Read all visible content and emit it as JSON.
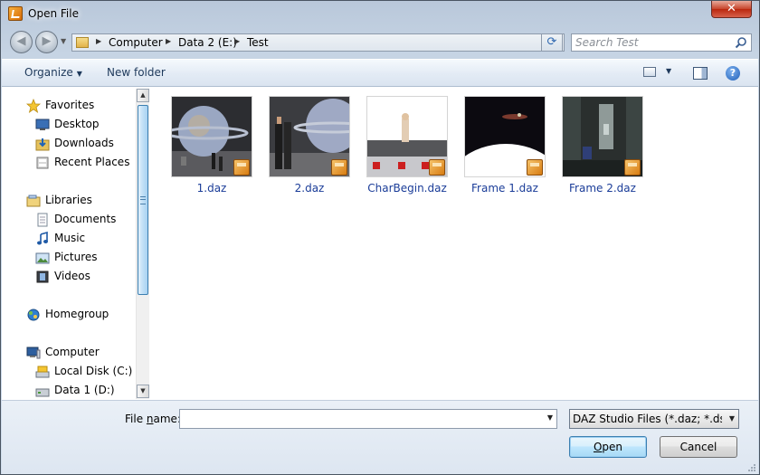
{
  "window": {
    "title": "Open File",
    "close_glyph": "✕"
  },
  "navbar": {
    "back_glyph": "◀",
    "forward_glyph": "▶",
    "breadcrumbs": [
      "Computer",
      "Data 2 (E:)",
      "Test"
    ],
    "search_placeholder": "Search Test"
  },
  "toolbar": {
    "organize_label": "Organize",
    "new_folder_label": "New folder",
    "help_glyph": "?"
  },
  "sidebar": {
    "groups": [
      {
        "label": "Favorites",
        "icon": "star-icon",
        "items": [
          {
            "label": "Desktop",
            "icon": "desktop-icon"
          },
          {
            "label": "Downloads",
            "icon": "downloads-icon"
          },
          {
            "label": "Recent Places",
            "icon": "recent-places-icon"
          }
        ]
      },
      {
        "label": "Libraries",
        "icon": "libraries-icon",
        "items": [
          {
            "label": "Documents",
            "icon": "documents-icon"
          },
          {
            "label": "Music",
            "icon": "music-icon"
          },
          {
            "label": "Pictures",
            "icon": "pictures-icon"
          },
          {
            "label": "Videos",
            "icon": "videos-icon"
          }
        ]
      },
      {
        "label": "Homegroup",
        "icon": "homegroup-icon",
        "items": []
      },
      {
        "label": "Computer",
        "icon": "computer-icon",
        "items": [
          {
            "label": "Local Disk (C:)",
            "icon": "local-disk-icon"
          },
          {
            "label": "Data 1 (D:)",
            "icon": "drive-icon"
          }
        ]
      }
    ]
  },
  "files": [
    {
      "name": "1.daz",
      "thumb": "space-scene-planet"
    },
    {
      "name": "2.daz",
      "thumb": "space-scene-figures"
    },
    {
      "name": "CharBegin.daz",
      "thumb": "figure-on-crates"
    },
    {
      "name": "Frame 1.daz",
      "thumb": "dark-planet-horizon"
    },
    {
      "name": "Frame 2.daz",
      "thumb": "dark-interior"
    }
  ],
  "bottom": {
    "file_name_label_prefix": "File ",
    "file_name_label_accel": "n",
    "file_name_label_suffix": "ame:",
    "file_name_value": "",
    "file_type_value": "DAZ Studio Files (*.daz; *.dsb; *",
    "open_label_accel": "O",
    "open_label_rest": "pen",
    "cancel_label": "Cancel"
  },
  "colors": {
    "link_blue": "#1a3c98",
    "accent": "#3c7fb1"
  }
}
